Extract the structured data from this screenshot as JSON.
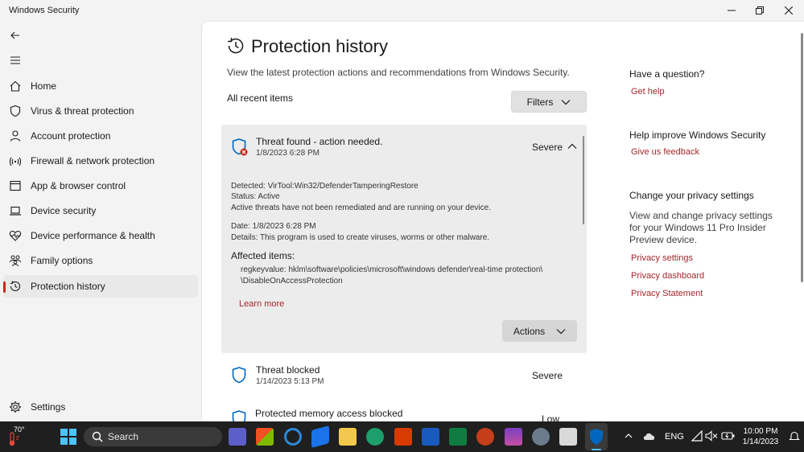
{
  "window": {
    "title": "Windows Security"
  },
  "sidebar": {
    "items": [
      {
        "label": "Home",
        "icon": "home-icon"
      },
      {
        "label": "Virus & threat protection",
        "icon": "shield-icon"
      },
      {
        "label": "Account protection",
        "icon": "person-icon"
      },
      {
        "label": "Firewall & network protection",
        "icon": "wifi-icon"
      },
      {
        "label": "App & browser control",
        "icon": "app-window-icon"
      },
      {
        "label": "Device security",
        "icon": "laptop-icon"
      },
      {
        "label": "Device performance & health",
        "icon": "heart-icon"
      },
      {
        "label": "Family options",
        "icon": "family-icon"
      },
      {
        "label": "Protection history",
        "icon": "history-icon",
        "active": true
      }
    ],
    "settings_label": "Settings"
  },
  "main": {
    "title": "Protection history",
    "description": "View the latest protection actions and recommendations from Windows Security.",
    "all_items_label": "All recent items",
    "filters_label": "Filters",
    "expanded_item": {
      "title": "Threat found - action needed.",
      "date": "1/8/2023 6:28 PM",
      "severity": "Severe",
      "detected": "Detected:  VirTool:Win32/DefenderTamperingRestore",
      "status": "Status:  Active",
      "status_note": "Active threats have not been remediated and are running on your device.",
      "date_line": "Date:  1/8/2023 6:28 PM",
      "details": "Details:  This program is used to create viruses, worms or other malware.",
      "affected_title": "Affected items:",
      "affected_line1": "regkeyvalue: hklm\\software\\policies\\microsoft\\windows defender\\real-time protection\\",
      "affected_line2": "\\DisableOnAccessProtection",
      "learn_more": "Learn more",
      "actions_label": "Actions"
    },
    "items": [
      {
        "title": "Threat blocked",
        "date": "1/14/2023 5:13 PM",
        "severity": "Severe"
      },
      {
        "title": "Protected memory access blocked",
        "date": "",
        "severity": "Low"
      }
    ]
  },
  "right_panel": {
    "question_heading": "Have a question?",
    "get_help": "Get help",
    "improve_heading": "Help improve Windows Security",
    "feedback": "Give us feedback",
    "privacy_heading": "Change your privacy settings",
    "privacy_text": "View and change privacy settings for your Windows 11 Pro Insider Preview device.",
    "privacy_settings": "Privacy settings",
    "privacy_dashboard": "Privacy dashboard",
    "privacy_statement": "Privacy Statement"
  },
  "taskbar": {
    "temperature": "70°",
    "search_label": "Search",
    "language": "ENG",
    "time": "10:00 PM",
    "date": "1/14/2023"
  },
  "colors": {
    "accent_link": "#a4262c",
    "active_indicator": "#c42b1c",
    "shield_blue": "#0067c0",
    "threat_red": "#c42b1c"
  }
}
